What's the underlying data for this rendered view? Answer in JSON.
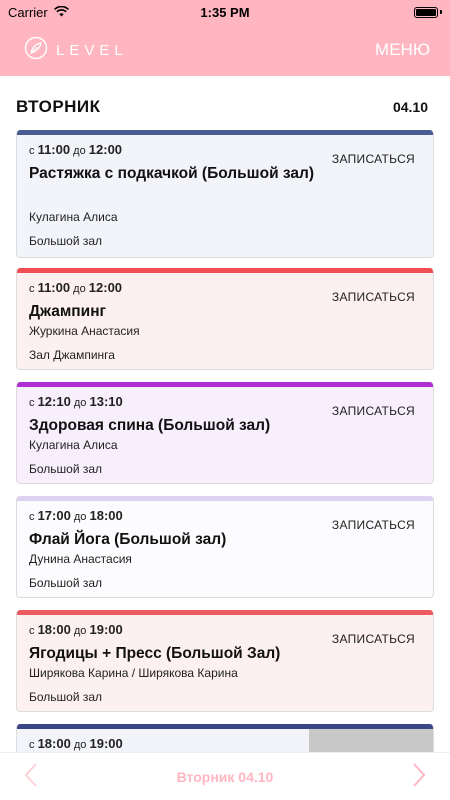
{
  "status_bar": {
    "carrier": "Carrier",
    "time": "1:35 PM"
  },
  "header": {
    "logo_text": "LEVEL",
    "menu_label": "МЕНЮ"
  },
  "day": {
    "name": "ВТОРНИК",
    "date": "04.10"
  },
  "signup_label": "ЗАПИСАТЬСЯ",
  "time_prefix_from": "с",
  "time_prefix_to": "до",
  "classes": [
    {
      "start": "11:00",
      "end": "12:00",
      "title": "Растяжка с подкачкой (Большой зал)",
      "trainer": "Кулагина Алиса",
      "room": "Большой зал",
      "accent": "#4a5a92",
      "bg": "#f2f4f9"
    },
    {
      "start": "11:00",
      "end": "12:00",
      "title": "Джампинг",
      "trainer": "Журкина Анастасия",
      "room": "Зал Джампинга",
      "accent": "#f04e54",
      "bg": "#fdf0f0"
    },
    {
      "start": "12:10",
      "end": "13:10",
      "title": "Здоровая спина (Большой зал)",
      "trainer": "Кулагина Алиса",
      "room": "Большой зал",
      "accent": "#b02fd2",
      "bg": "#f7effb"
    },
    {
      "start": "17:00",
      "end": "18:00",
      "title": "Флай Йога (Большой зал)",
      "trainer": "Дунина Анастасия",
      "room": "Большой зал",
      "accent": "#ddd2f0",
      "bg": "#fcfbfe"
    },
    {
      "start": "18:00",
      "end": "19:00",
      "title": "Ягодицы + Пресс (Большой Зал)",
      "trainer": "Ширякова Карина / Ширякова Карина",
      "room": "Большой зал",
      "accent": "#ec5a62",
      "bg": "#fdf0f0"
    },
    {
      "start": "18:00",
      "end": "19:00",
      "title": "",
      "trainer": "",
      "room": "",
      "accent": "#3b4686",
      "bg": "#f2f4f9"
    }
  ],
  "footer": {
    "label": "Вторник 04.10"
  },
  "colors": {
    "brand_pink": "#ffb6c1"
  },
  "icons": {
    "logo": "leaf-circle-icon",
    "prev": "chevron-left-icon",
    "next": "chevron-right-icon",
    "wifi": "wifi-icon",
    "battery": "battery-icon"
  }
}
